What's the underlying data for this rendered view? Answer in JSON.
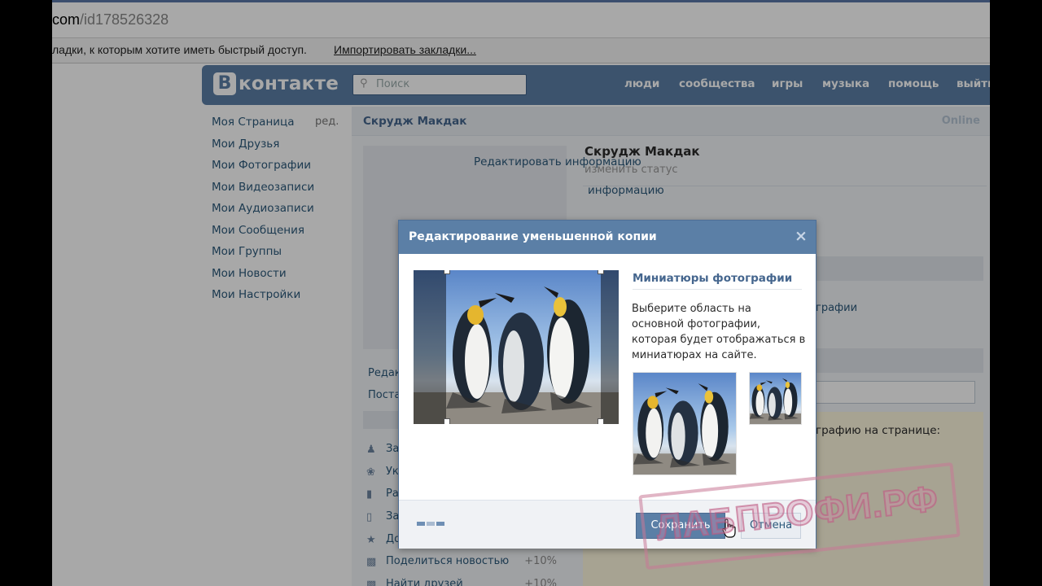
{
  "browser": {
    "address_prefix": "com",
    "address_path": "/id178526328",
    "bookmarks_message": "ладки, к которым хотите иметь быстрый доступ.",
    "import_bookmarks": "Импортировать закладки..."
  },
  "header": {
    "logo_letter": "В",
    "logo_text": "контакте",
    "search_placeholder": "Поиск",
    "nav": [
      "люди",
      "сообщества",
      "игры",
      "музыка",
      "помощь",
      "выйти"
    ]
  },
  "left_menu": {
    "items": [
      "Моя Страница",
      "Мои Друзья",
      "Мои Фотографии",
      "Мои Видеозаписи",
      "Мои Аудиозаписи",
      "Мои Сообщения",
      "Мои Группы",
      "Мои Новости",
      "Мои Настройки"
    ],
    "edit_label": "ред."
  },
  "profile": {
    "bar_name": "Скрудж Макдак",
    "online": "Online",
    "name": "Скрудж Макдак",
    "status": "изменить статус",
    "edit_info": "Редактировать информацию",
    "info2": "информацию",
    "photos_partial": "графии",
    "photo_on_page": "графию на странице:",
    "side_links": [
      "Редак",
      "Поста"
    ],
    "activity": [
      {
        "icon": "user-icon",
        "label": "За",
        "pct": ""
      },
      {
        "icon": "gift-icon",
        "label": "Ук",
        "pct": ""
      },
      {
        "icon": "briefcase-icon",
        "label": "Ра",
        "pct": ""
      },
      {
        "icon": "phone-icon",
        "label": "За",
        "pct": ""
      },
      {
        "icon": "star-icon",
        "label": "До",
        "pct": ""
      },
      {
        "icon": "comment-icon",
        "label": "Поделиться новостью",
        "pct": "+10%"
      },
      {
        "icon": "comment-icon",
        "label": "Найти друзей",
        "pct": "+10%"
      }
    ]
  },
  "dialog": {
    "title": "Редактирование уменьшенной копии",
    "close": "×",
    "thumb_title": "Миниатюры фотографии",
    "thumb_desc": "Выберите область на основной фотографии, которая будет отображаться в миниатюрах на сайте.",
    "save": "Сохранить",
    "cancel": "Отмена"
  },
  "watermark": "ЛАБПРОФИ.РФ",
  "colors": {
    "vk_blue": "#5b7fa6",
    "link": "#2b587a"
  }
}
